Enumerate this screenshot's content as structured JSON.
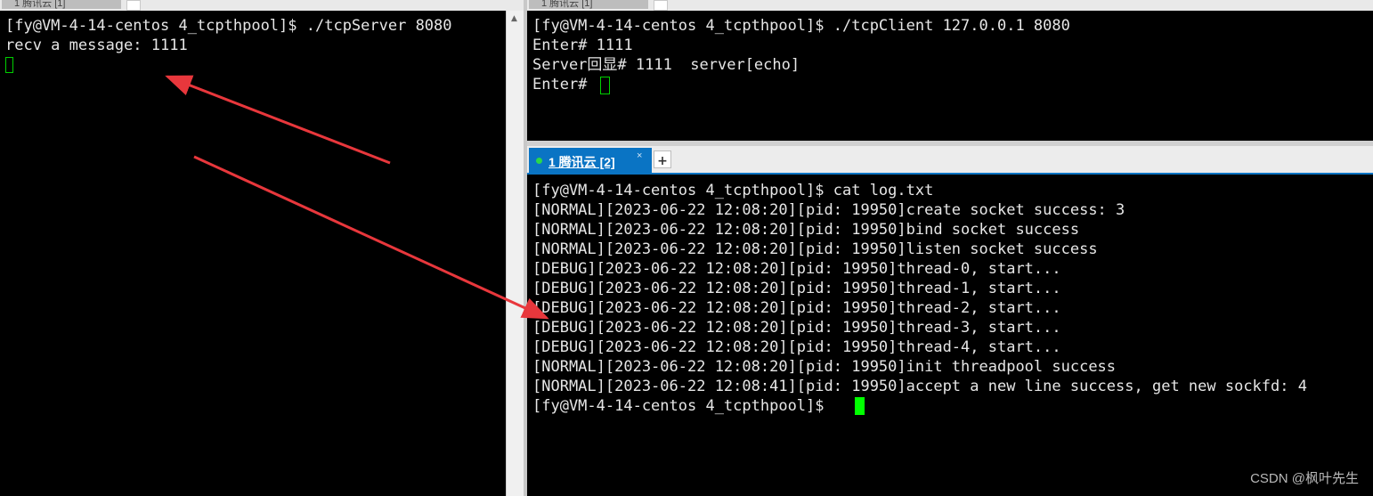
{
  "colors": {
    "terminal_bg": "#000000",
    "terminal_text": "#e6e6e6",
    "cursor": "#00ff00",
    "active_tab": "#0a74c4",
    "arrow": "#e8373c"
  },
  "left_pane": {
    "tab_label": "1 腾讯云 [1]",
    "lines": [
      "[fy@VM-4-14-centos 4_tcpthpool]$ ./tcpServer 8080",
      "recv a message: 1111"
    ]
  },
  "top_right_pane": {
    "tab_label": "1 腾讯云 [1]",
    "lines": [
      "[fy@VM-4-14-centos 4_tcpthpool]$ ./tcpClient 127.0.0.1 8080",
      "Enter# 1111",
      "Server回显# 1111  server[echo]",
      "Enter# "
    ]
  },
  "bottom_right_pane": {
    "tab": {
      "dot_icon": "status-dot-icon",
      "label": "1 腾讯云 [2]",
      "close_glyph": "×",
      "add_glyph": "+"
    },
    "lines": [
      "[fy@VM-4-14-centos 4_tcpthpool]$ cat log.txt",
      "[NORMAL][2023-06-22 12:08:20][pid: 19950]create socket success: 3",
      "[NORMAL][2023-06-22 12:08:20][pid: 19950]bind socket success",
      "[NORMAL][2023-06-22 12:08:20][pid: 19950]listen socket success",
      "[DEBUG][2023-06-22 12:08:20][pid: 19950]thread-0, start...",
      "[DEBUG][2023-06-22 12:08:20][pid: 19950]thread-1, start...",
      "[DEBUG][2023-06-22 12:08:20][pid: 19950]thread-2, start...",
      "[DEBUG][2023-06-22 12:08:20][pid: 19950]thread-3, start...",
      "[DEBUG][2023-06-22 12:08:20][pid: 19950]thread-4, start...",
      "[NORMAL][2023-06-22 12:08:20][pid: 19950]init threadpool success",
      "[NORMAL][2023-06-22 12:08:41][pid: 19950]accept a new line success, get new sockfd: 4",
      "[fy@VM-4-14-centos 4_tcpthpool]$ "
    ]
  },
  "watermark": "CSDN @枫叶先生"
}
